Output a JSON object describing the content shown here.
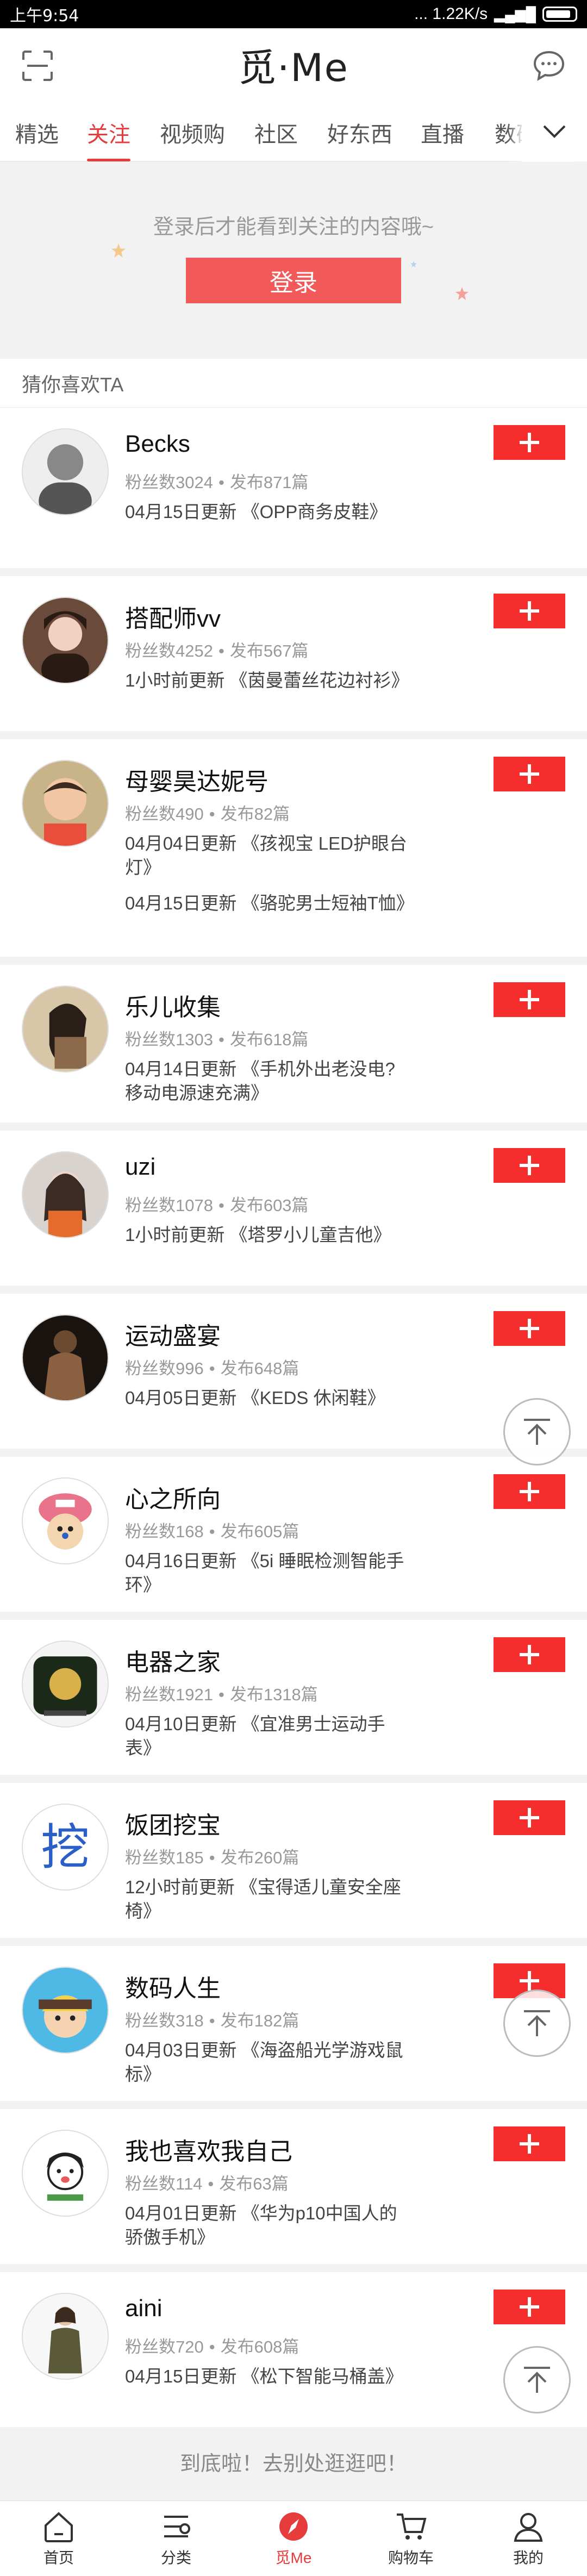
{
  "status_bar": {
    "time": "上午9:54",
    "network_speed": "... 1.22K/s"
  },
  "header": {
    "title": "觅·Me",
    "scan_icon": "scan-icon",
    "chat_icon": "message-icon"
  },
  "tabs": [
    {
      "label": "精选",
      "active": false
    },
    {
      "label": "关注",
      "active": true
    },
    {
      "label": "视频购",
      "active": false
    },
    {
      "label": "社区",
      "active": false
    },
    {
      "label": "好东西",
      "active": false
    },
    {
      "label": "直播",
      "active": false
    },
    {
      "label": "数码",
      "active": false
    }
  ],
  "login": {
    "hint": "登录后才能看到关注的内容哦~",
    "button_label": "登录"
  },
  "section_label": "猜你喜欢TA",
  "accent_color": "#f52d2d",
  "users": [
    {
      "name": "Becks",
      "fans": "粉丝数3024",
      "posts": "发布871篇",
      "update": "04月15日更新 《OPP商务皮鞋》"
    },
    {
      "name": "搭配师vv",
      "fans": "粉丝数4252",
      "posts": "发布567篇",
      "update": "1小时前更新 《茵曼蕾丝花边衬衫》"
    },
    {
      "name": "母婴昊达妮号",
      "fans": "粉丝数490",
      "posts": "发布82篇",
      "update": "04月04日更新 《孩视宝 LED护眼台灯》",
      "update2": "04月15日更新 《骆驼男士短袖T恤》"
    },
    {
      "name": "乐儿收集",
      "fans": "粉丝数1303",
      "posts": "发布618篇",
      "update": "04月14日更新 《手机外出老没电?移动电源速充满》"
    },
    {
      "name": "uzi",
      "fans": "粉丝数1078",
      "posts": "发布603篇",
      "update": "1小时前更新 《塔罗小儿童吉他》"
    },
    {
      "name": "运动盛宴",
      "fans": "粉丝数996",
      "posts": "发布648篇",
      "update": "04月05日更新 《KEDS 休闲鞋》"
    },
    {
      "name": "心之所向",
      "fans": "粉丝数168",
      "posts": "发布605篇",
      "update": "04月16日更新 《5i 睡眠检测智能手环》"
    },
    {
      "name": "电器之家",
      "fans": "粉丝数1921",
      "posts": "发布1318篇",
      "update": "04月10日更新 《宜准男士运动手表》"
    },
    {
      "name": "饭团挖宝",
      "fans": "粉丝数185",
      "posts": "发布260篇",
      "update": "12小时前更新 《宝得适儿童安全座椅》"
    },
    {
      "name": "数码人生",
      "fans": "粉丝数318",
      "posts": "发布182篇",
      "update": "04月03日更新 《海盗船光学游戏鼠标》"
    },
    {
      "name": "我也喜欢我自己",
      "fans": "粉丝数114",
      "posts": "发布63篇",
      "update": "04月01日更新 《华为p10中国人的骄傲手机》"
    },
    {
      "name": "aini",
      "fans": "粉丝数720",
      "posts": "发布608篇",
      "update": "04月15日更新 《松下智能马桶盖》"
    }
  ],
  "end_note": "到底啦！去别处逛逛吧！",
  "bottom_nav": [
    {
      "label": "首页",
      "icon": "home-icon",
      "active": false
    },
    {
      "label": "分类",
      "icon": "category-icon",
      "active": false
    },
    {
      "label": "觅Me",
      "icon": "compass-icon",
      "active": true
    },
    {
      "label": "购物车",
      "icon": "cart-icon",
      "active": false
    },
    {
      "label": "我的",
      "icon": "profile-icon",
      "active": false
    }
  ]
}
